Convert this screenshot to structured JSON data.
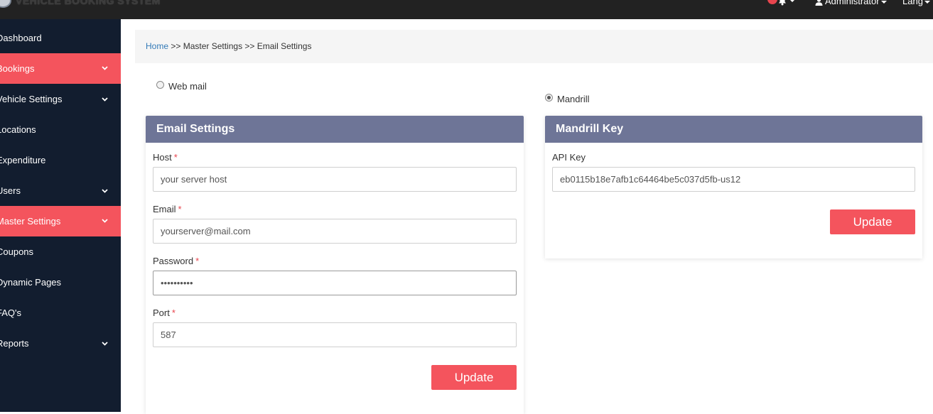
{
  "app": {
    "brand": "VEHICLE BOOKING SYSTEM"
  },
  "topbar": {
    "user": "Administrator",
    "lang": "Lang"
  },
  "sidebar": {
    "items": [
      {
        "label": "Dashboard",
        "has_submenu": false,
        "active": false
      },
      {
        "label": "Bookings",
        "has_submenu": true,
        "active": true
      },
      {
        "label": "Vehicle Settings",
        "has_submenu": true,
        "active": false
      },
      {
        "label": "Locations",
        "has_submenu": false,
        "active": false
      },
      {
        "label": "Expenditure",
        "has_submenu": false,
        "active": false
      },
      {
        "label": "Users",
        "has_submenu": true,
        "active": false
      },
      {
        "label": "Master Settings",
        "has_submenu": true,
        "active": true
      },
      {
        "label": "Coupons",
        "has_submenu": false,
        "active": false
      },
      {
        "label": "Dynamic Pages",
        "has_submenu": false,
        "active": false
      },
      {
        "label": "FAQ's",
        "has_submenu": false,
        "active": false
      },
      {
        "label": "Reports",
        "has_submenu": true,
        "active": false
      }
    ]
  },
  "breadcrumb": {
    "home": "Home",
    "rest": " >> Master Settings >> Email Settings"
  },
  "options": {
    "webmail_label": "Web mail",
    "webmail_checked": false,
    "mandrill_label": "Mandrill",
    "mandrill_checked": true
  },
  "email_panel": {
    "title": "Email Settings",
    "host_label": "Host",
    "host_value": "your server host",
    "email_label": "Email",
    "email_value": "yourserver@mail.com",
    "password_label": "Password",
    "password_value": "1234567890",
    "port_label": "Port",
    "port_value": "587",
    "required_mark": "*",
    "update_label": "Update"
  },
  "mandrill_panel": {
    "title": "Mandrill Key",
    "api_label": "API Key",
    "api_value": "eb0115b18e7afb1c64464be5c037d5fb-us12",
    "update_label": "Update"
  },
  "colors": {
    "sidebar_bg": "#121d2f",
    "accent": "#f4545d",
    "panel_header": "#6e7597",
    "topbar_bg": "#222222"
  }
}
